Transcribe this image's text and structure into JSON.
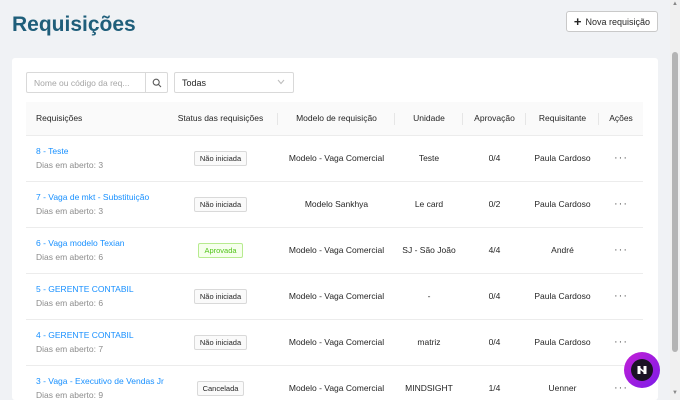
{
  "page": {
    "title": "Requisições",
    "new_button_label": "Nova requisição"
  },
  "filters": {
    "search_placeholder": "Nome ou código da req...",
    "status_value": "Todas"
  },
  "table": {
    "columns": [
      "Requisições",
      "Status das requisições",
      "Modelo de requisição",
      "Unidade",
      "Aprovação",
      "Requisitante",
      "Ações"
    ],
    "rows": [
      {
        "title": "8 - Teste",
        "days": "Dias em aberto: 3",
        "status": "Não iniciada",
        "model": "Modelo - Vaga Comercial",
        "unit": "Teste",
        "approval": "0/4",
        "requester": "Paula Cardoso",
        "actions": "···"
      },
      {
        "title": "7 - Vaga de mkt - Substituição",
        "days": "Dias em aberto: 3",
        "status": "Não iniciada",
        "model": "Modelo Sankhya",
        "unit": "Le card",
        "approval": "0/2",
        "requester": "Paula Cardoso",
        "actions": "···"
      },
      {
        "title": "6 - Vaga modelo Texian",
        "days": "Dias em aberto: 6",
        "status": "Aprovada",
        "model": "Modelo - Vaga Comercial",
        "unit": "SJ - São João",
        "approval": "4/4",
        "requester": "André",
        "actions": "···"
      },
      {
        "title": "5 - GERENTE CONTABIL",
        "days": "Dias em aberto: 6",
        "status": "Não iniciada",
        "model": "Modelo - Vaga Comercial",
        "unit": "-",
        "approval": "0/4",
        "requester": "Paula Cardoso",
        "actions": "···"
      },
      {
        "title": "4 - GERENTE CONTABIL",
        "days": "Dias em aberto: 7",
        "status": "Não iniciada",
        "model": "Modelo - Vaga Comercial",
        "unit": "matriz",
        "approval": "0/4",
        "requester": "Paula Cardoso",
        "actions": "···"
      },
      {
        "title": "3 - Vaga - Executivo de Vendas Jr",
        "days": "Dias em aberto: 9",
        "status": "Cancelada",
        "model": "Modelo - Vaga Comercial",
        "unit": "MINDSIGHT",
        "approval": "1/4",
        "requester": "Uenner",
        "actions": "···"
      }
    ]
  },
  "colors": {
    "title": "#1f5e7a",
    "link": "#1890ff",
    "approved_tag": "#52c41a",
    "chat_gradient_start": "#c41fd6",
    "chat_gradient_end": "#7a1ce8"
  },
  "icons": {
    "new_button": "plus-icon",
    "search": "search-icon",
    "select": "chevron-down-icon",
    "chat": "chat-assistant-icon"
  }
}
